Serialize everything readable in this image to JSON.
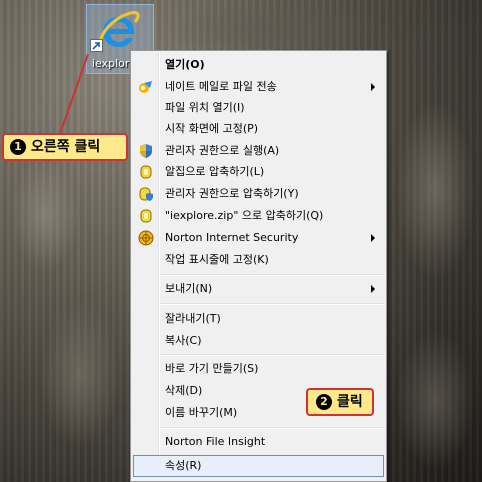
{
  "desktop": {
    "icon_label": "iexplore"
  },
  "context_menu": {
    "groups": [
      [
        {
          "label": "열기(O)",
          "bold": true,
          "icon": ""
        },
        {
          "label": "네이트 메일로 파일 전송",
          "icon": "mail-send-icon",
          "submenu": true
        },
        {
          "label": "파일 위치 열기(I)",
          "icon": ""
        },
        {
          "label": "시작 화면에 고정(P)",
          "icon": ""
        },
        {
          "label": "관리자 권한으로 실행(A)",
          "icon": "uac-shield-icon"
        },
        {
          "label": "알집으로 압축하기(L)",
          "icon": "alzip-icon"
        },
        {
          "label": "관리자 권한으로 압축하기(Y)",
          "icon": "alzip-shield-icon"
        },
        {
          "label": "\"iexplore.zip\" 으로 압축하기(Q)",
          "icon": "alzip-icon"
        },
        {
          "label": "Norton Internet Security",
          "icon": "norton-icon",
          "submenu": true
        },
        {
          "label": "작업 표시줄에 고정(K)",
          "icon": ""
        }
      ],
      [
        {
          "label": "보내기(N)",
          "icon": "",
          "submenu": true
        }
      ],
      [
        {
          "label": "잘라내기(T)",
          "icon": ""
        },
        {
          "label": "복사(C)",
          "icon": ""
        }
      ],
      [
        {
          "label": "바로 가기 만들기(S)",
          "icon": ""
        },
        {
          "label": "삭제(D)",
          "icon": ""
        },
        {
          "label": "이름 바꾸기(M)",
          "icon": ""
        }
      ],
      [
        {
          "label": "Norton File Insight",
          "icon": ""
        },
        {
          "label": "속성(R)",
          "icon": "",
          "selected": true
        }
      ]
    ]
  },
  "callouts": {
    "step1": {
      "num": "1",
      "text": "오른쪽 클릭"
    },
    "step2": {
      "num": "2",
      "text": "클릭"
    }
  },
  "colors": {
    "callout_bg": "#fde989",
    "callout_border": "#cc3333",
    "selection_border": "#6f8fbf"
  }
}
